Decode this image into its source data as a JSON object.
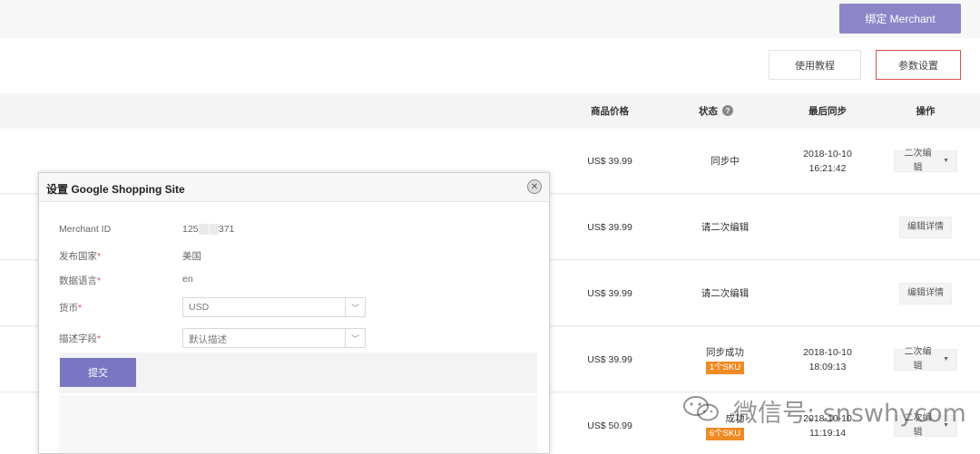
{
  "header": {
    "bind_button": "绑定 Merchant"
  },
  "toolbar": {
    "tutorial": "使用教程",
    "params": "参数设置"
  },
  "table": {
    "columns": {
      "price": "商品价格",
      "status": "状态",
      "last_sync": "最后同步",
      "action": "操作"
    },
    "help_icon": "?",
    "rows": [
      {
        "price": "US$ 39.99",
        "status": "同步中",
        "badge": "",
        "date": "2018-10-10",
        "time": "16:21:42",
        "action": "二次编辑",
        "dropdown": true
      },
      {
        "price": "US$ 39.99",
        "status": "请二次编辑",
        "badge": "",
        "date": "",
        "time": "",
        "action": "编辑详情",
        "dropdown": false
      },
      {
        "price": "US$ 39.99",
        "status": "请二次编辑",
        "badge": "",
        "date": "",
        "time": "",
        "action": "编辑详情",
        "dropdown": false
      },
      {
        "price": "US$ 39.99",
        "status": "同步成功",
        "badge": "1个SKU",
        "date": "2018-10-10",
        "time": "18:09:13",
        "action": "二次编辑",
        "dropdown": true
      },
      {
        "price": "US$ 50.99",
        "status": "成功",
        "badge": "6个SKU",
        "date": "2018-10-10",
        "time": "11:19:14",
        "action": "二次编辑",
        "dropdown": true
      }
    ]
  },
  "dialog": {
    "title": "设置 Google Shopping Site",
    "close": "✕",
    "fields": {
      "merchant_id": {
        "label": "Merchant ID",
        "value": "125░░░371"
      },
      "country": {
        "label": "发布国家",
        "value": "美国"
      },
      "language": {
        "label": "数据语言",
        "value": "en"
      },
      "currency": {
        "label": "货币",
        "value": "USD"
      },
      "description": {
        "label": "描述字段",
        "value": "默认描述"
      }
    },
    "required_mark": "*",
    "submit": "提交"
  },
  "watermark": {
    "text": "微信号: snswhycom"
  },
  "colors": {
    "accent": "#8c86c9",
    "badge": "#f08a24",
    "highlight_border": "#d9534f"
  }
}
